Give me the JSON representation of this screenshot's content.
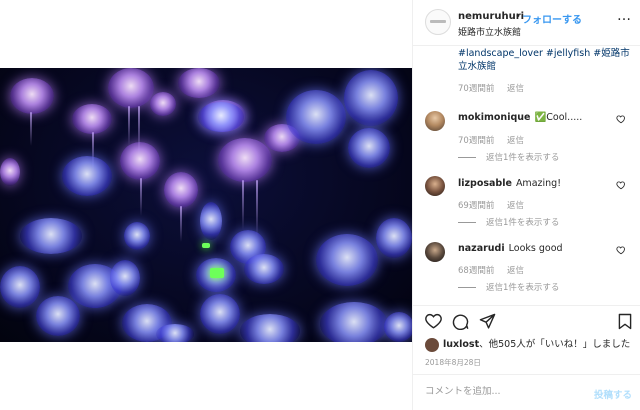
{
  "post": {
    "username": "nemuruhuri",
    "separator": "•",
    "follow_label": "フォローする",
    "location": "姫路市立水族館",
    "more_label": "…"
  },
  "caption": {
    "tags": "#landscape_lover #jellyfish #姫路市立水族館",
    "age": "70週間前",
    "reply_label": "返信"
  },
  "comments": [
    {
      "user": "mokimonique",
      "text": "✅Cool.....",
      "age": "70週間前",
      "reply_label": "返信",
      "view_replies": "返信1件を表示する"
    },
    {
      "user": "lizposable",
      "text": "Amazing!",
      "age": "69週間前",
      "reply_label": "返信",
      "view_replies": "返信1件を表示する"
    },
    {
      "user": "nazarudi",
      "text": "Looks good",
      "age": "68週間前",
      "reply_label": "返信",
      "view_replies": "返信1件を表示する"
    }
  ],
  "likes": {
    "user": "luxlost",
    "text": "、他505人が「いいね！」しました"
  },
  "date": "2018年8月28日",
  "add_comment": {
    "placeholder": "コメントを追加...",
    "post_label": "投稿する"
  },
  "colors": {
    "link_blue": "#3897f0",
    "hashtag": "#003569",
    "muted": "#999999",
    "post_disabled": "#b2dffc"
  }
}
